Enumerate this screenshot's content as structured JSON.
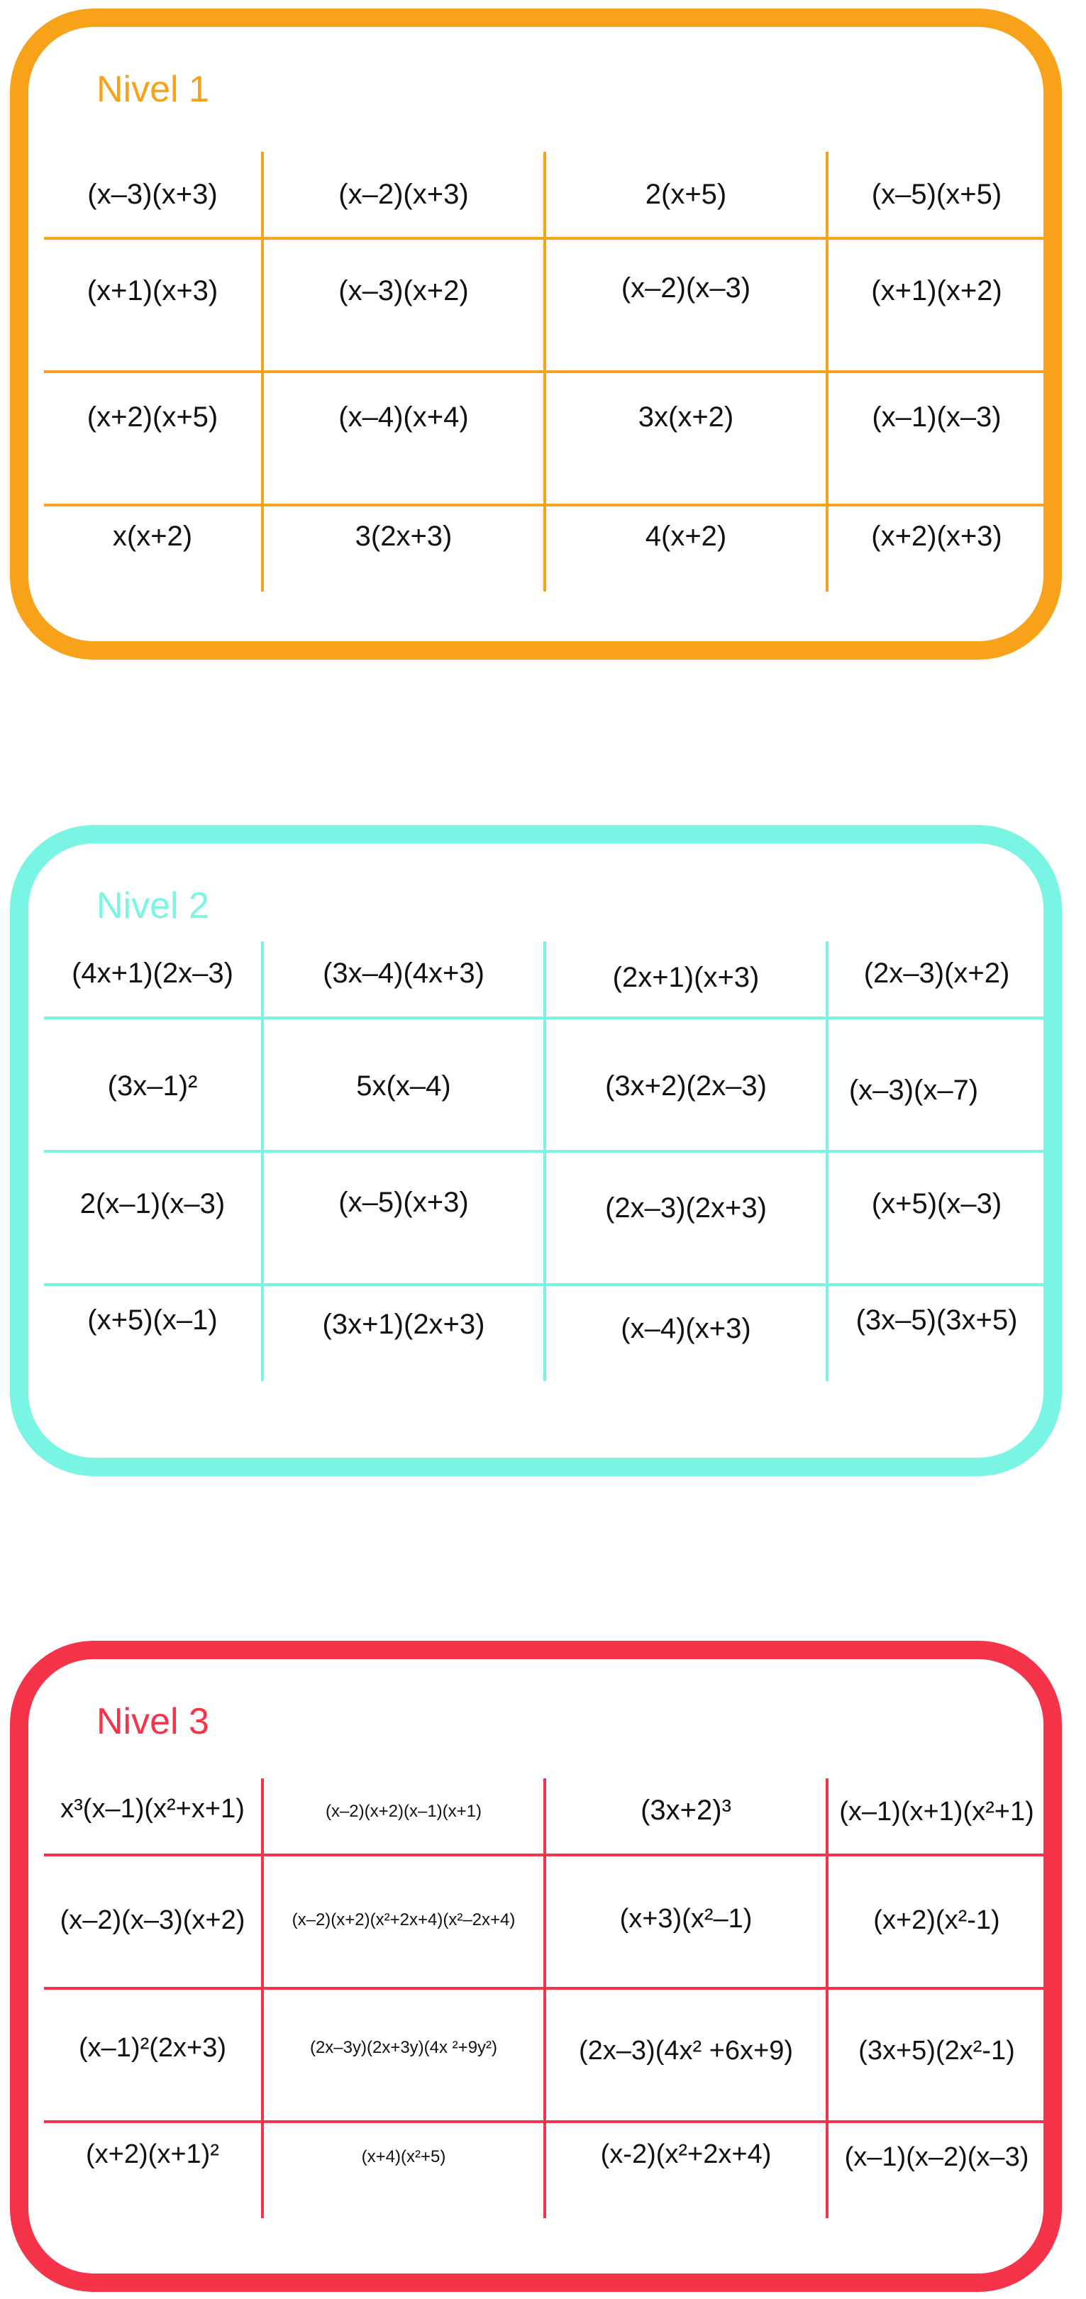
{
  "colors": {
    "level_1": "#F8A21A",
    "level_2": "#7AF5E3",
    "level_3": "#F5344A",
    "text": "#111111"
  },
  "levels": [
    {
      "title": "Nivel 1",
      "rows": [
        [
          "(x–3)(x+3)",
          "(x–2)(x+3)",
          "2(x+5)",
          "(x–5)(x+5)"
        ],
        [
          "(x+1)(x+3)",
          "(x–3)(x+2)",
          "(x–2)(x–3)",
          "(x+1)(x+2)"
        ],
        [
          "(x+2)(x+5)",
          "(x–4)(x+4)",
          "3x(x+2)",
          "(x–1)(x–3)"
        ],
        [
          "x(x+2)",
          "3(2x+3)",
          "4(x+2)",
          "(x+2)(x+3)"
        ]
      ]
    },
    {
      "title": "Nivel 2",
      "rows": [
        [
          "(4x+1)(2x–3)",
          "(3x–4)(4x+3)",
          "(2x+1)(x+3)",
          "(2x–3)(x+2)"
        ],
        [
          "(3x–1)²",
          "5x(x–4)",
          "(3x+2)(2x–3)",
          "(x–3)(x–7)"
        ],
        [
          "2(x–1)(x–3)",
          "(x–5)(x+3)",
          "(2x–3)(2x+3)",
          "(x+5)(x–3)"
        ],
        [
          "(x+5)(x–1)",
          "(3x+1)(2x+3)",
          "(x–4)(x+3)",
          "(3x–5)(3x+5)"
        ]
      ]
    },
    {
      "title": "Nivel 3",
      "rows": [
        [
          "x³(x–1)(x²+x+1)",
          "(x–2)(x+2)(x–1)(x+1)",
          "(3x+2)³",
          "(x–1)(x+1)(x²+1)"
        ],
        [
          "(x–2)(x–3)(x+2)",
          "(x–2)(x+2)(x²+2x+4)(x²–2x+4)",
          "(x+3)(x²–1)",
          "(x+2)(x²-1)"
        ],
        [
          "(x–1)²(2x+3)",
          "(2x–3y)(2x+3y)(4x ²+9y²)",
          "(2x–3)(4x² +6x+9)",
          "(3x+5)(2x²-1)"
        ],
        [
          "(x+2)(x+1)²",
          "(x+4)(x²+5)",
          "(x-2)(x²+2x+4)",
          "(x–1)(x–2)(x–3)"
        ]
      ]
    }
  ]
}
